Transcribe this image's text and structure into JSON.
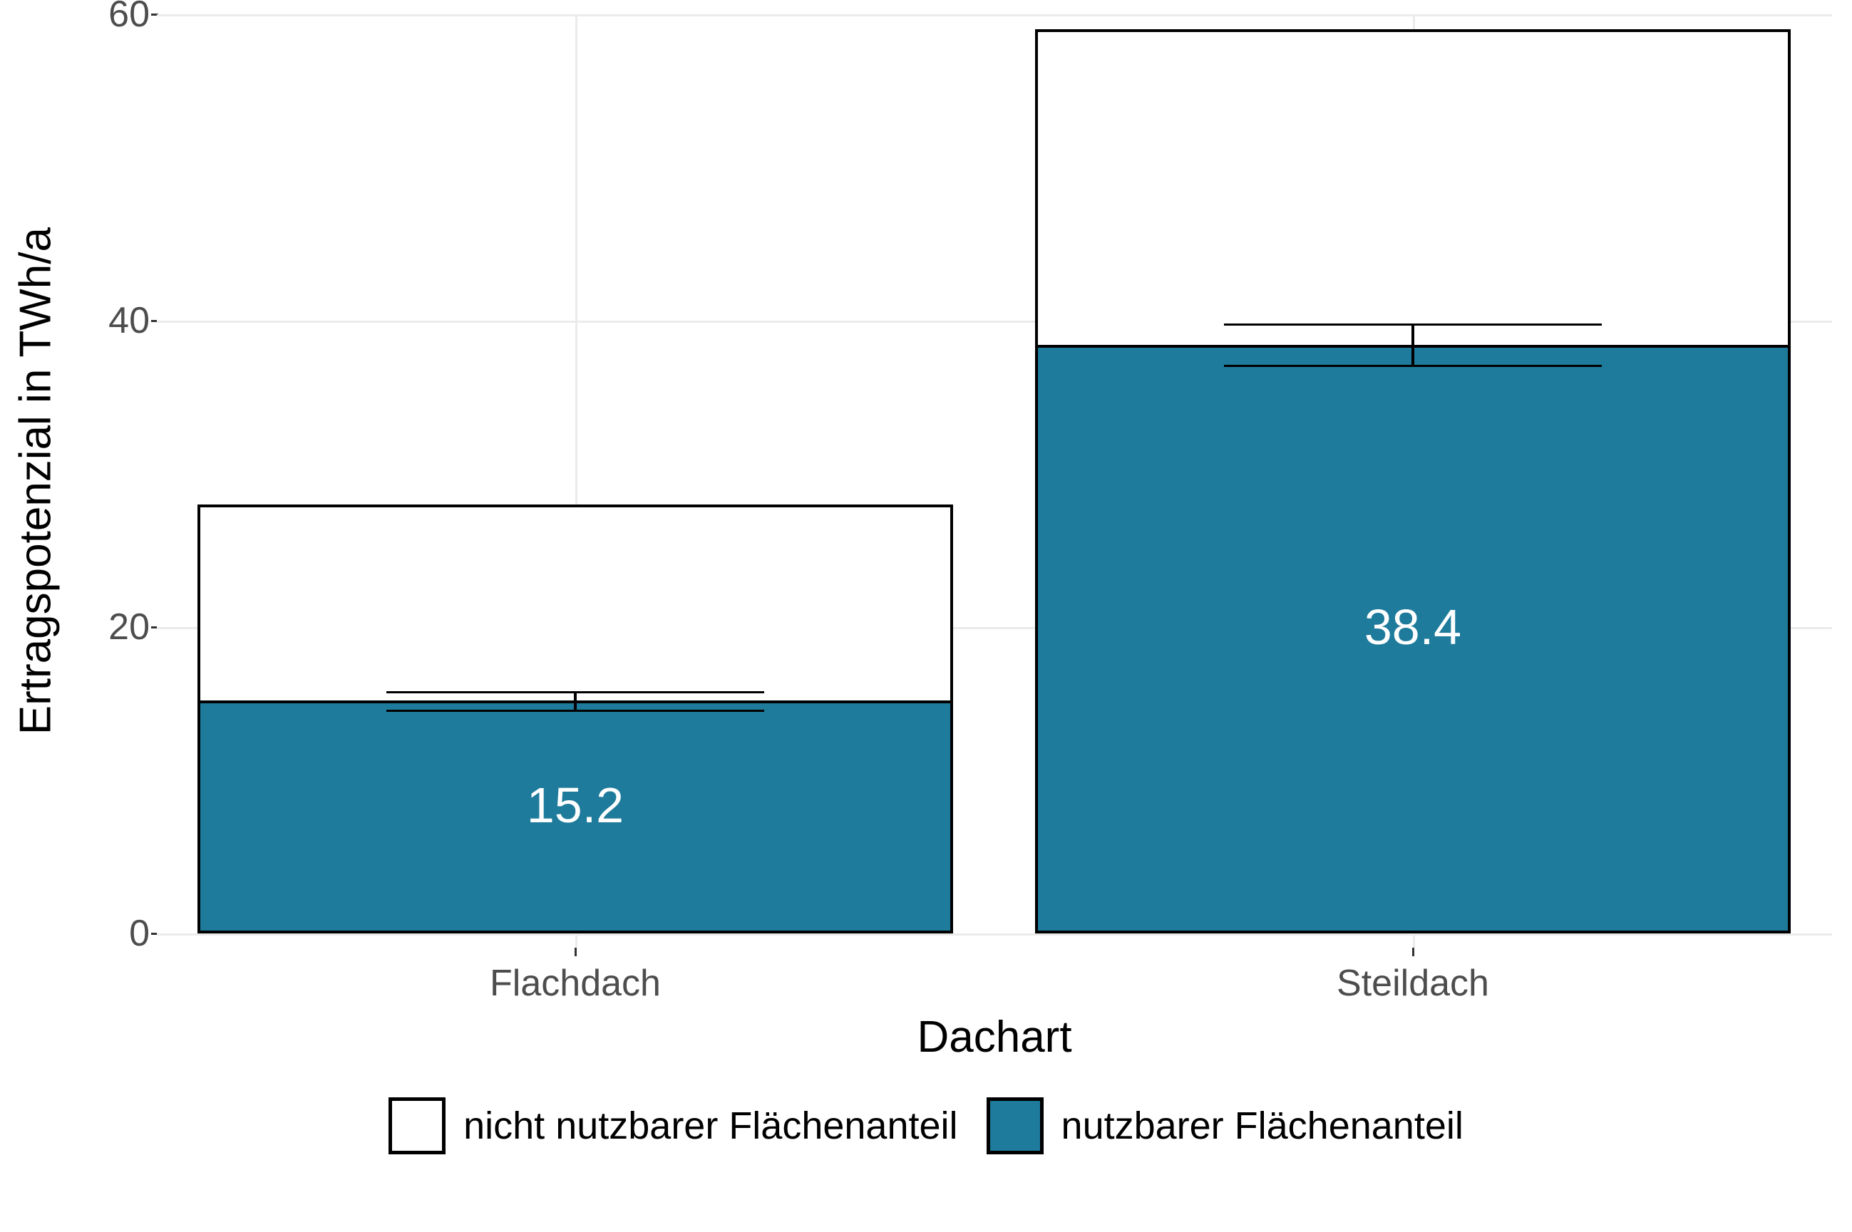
{
  "chart_data": {
    "type": "bar",
    "stacked": true,
    "categories": [
      "Flachdach",
      "Steildach"
    ],
    "series": [
      {
        "name": "nutzbarer Flächenanteil",
        "values": [
          15.2,
          38.4
        ],
        "color": "#1e7b9b"
      },
      {
        "name": "nicht nutzbarer Flächenanteil",
        "values": [
          12.8,
          20.6
        ],
        "color": "#ffffff"
      }
    ],
    "totals": [
      28.0,
      59.0
    ],
    "error_bars": [
      {
        "center": 15.2,
        "low": 14.6,
        "high": 15.8
      },
      {
        "center": 38.4,
        "low": 37.1,
        "high": 39.8
      }
    ],
    "data_labels": [
      "15.2",
      "38.4"
    ],
    "xlabel": "Dachart",
    "ylabel": "Ertragspotenzial in TWh/a",
    "ylim": [
      0,
      60
    ],
    "yticks": [
      0,
      20,
      40,
      60
    ],
    "legend_position": "bottom"
  },
  "yticks": {
    "t0": "0",
    "t1": "20",
    "t2": "40",
    "t3": "60"
  },
  "xticks": {
    "c0": "Flachdach",
    "c1": "Steildach"
  },
  "labels": {
    "x": "Dachart",
    "y": "Ertragspotenzial in TWh/a"
  },
  "bar_text": {
    "b0": "15.2",
    "b1": "38.4"
  },
  "legend": {
    "item0": "nicht nutzbarer Flächenanteil",
    "item1": "nutzbarer Flächenanteil"
  }
}
